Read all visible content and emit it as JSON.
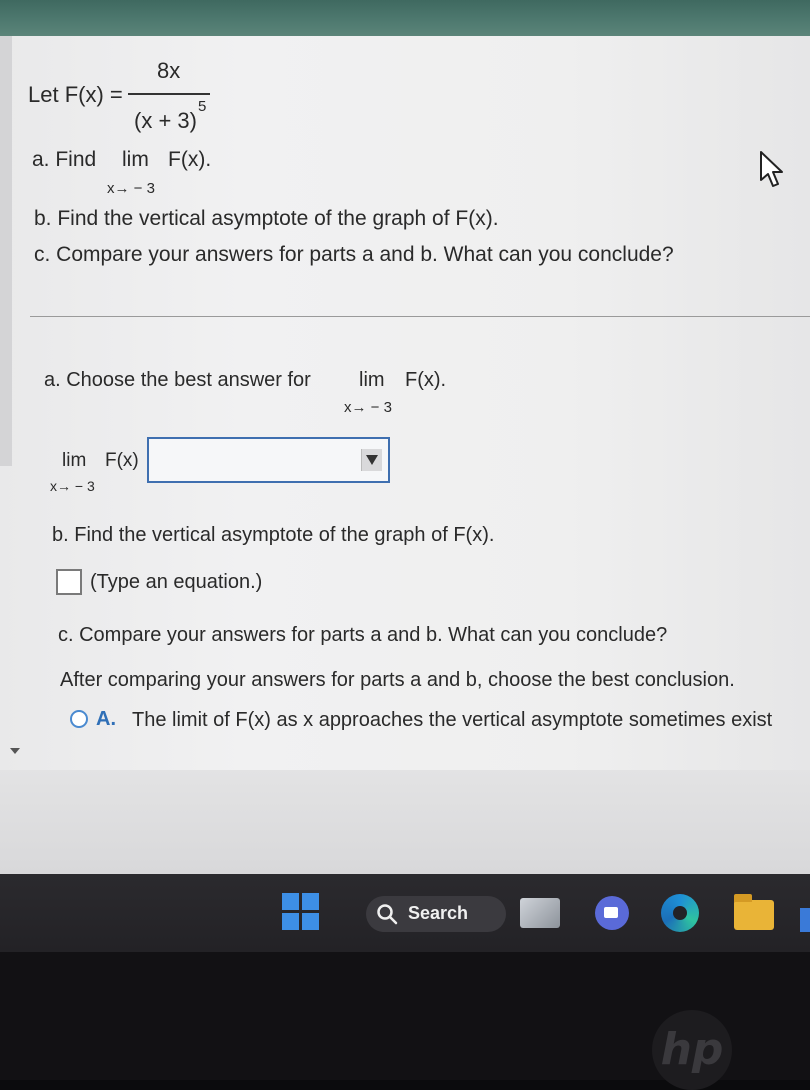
{
  "question": {
    "let_label": "Let F(x) =",
    "numerator": "8x",
    "denominator": "(x + 3)",
    "exponent": "5",
    "part_a_prefix": "a. Find",
    "part_a_lim": "lim",
    "part_a_func": "F(x).",
    "part_a_sub": "x→ − 3",
    "part_b": "b. Find the vertical asymptote of the graph of F(x).",
    "part_c": "c. Compare your answers for parts a and b. What can you conclude?"
  },
  "part_a": {
    "label": "a. Choose the best answer for",
    "lim": "lim",
    "func": "F(x).",
    "sub": "x→ − 3",
    "answer_lim": "lim",
    "answer_func": "F(x)",
    "answer_sub": "x→ − 3",
    "dropdown_value": ""
  },
  "part_b": {
    "label": "b. Find the vertical asymptote of the graph of F(x).",
    "hint": "(Type an equation.)"
  },
  "part_c": {
    "label": "c. Compare your answers for parts a and b. What can you conclude?",
    "instruction": "After comparing your answers for parts a and b, choose the best conclusion.",
    "option_a_letter": "A.",
    "option_a_text": "The limit of F(x) as x approaches the vertical asymptote sometimes exist"
  },
  "taskbar": {
    "search_label": "Search",
    "icons": [
      "windows-start-icon",
      "search-icon",
      "file-explorer-icon",
      "meet-icon",
      "edge-icon",
      "folder-icon"
    ]
  },
  "colors": {
    "accent_blue": "#3f6fb0",
    "radio_blue": "#4a8ad0",
    "windows_blue": "#3d8fe6"
  }
}
